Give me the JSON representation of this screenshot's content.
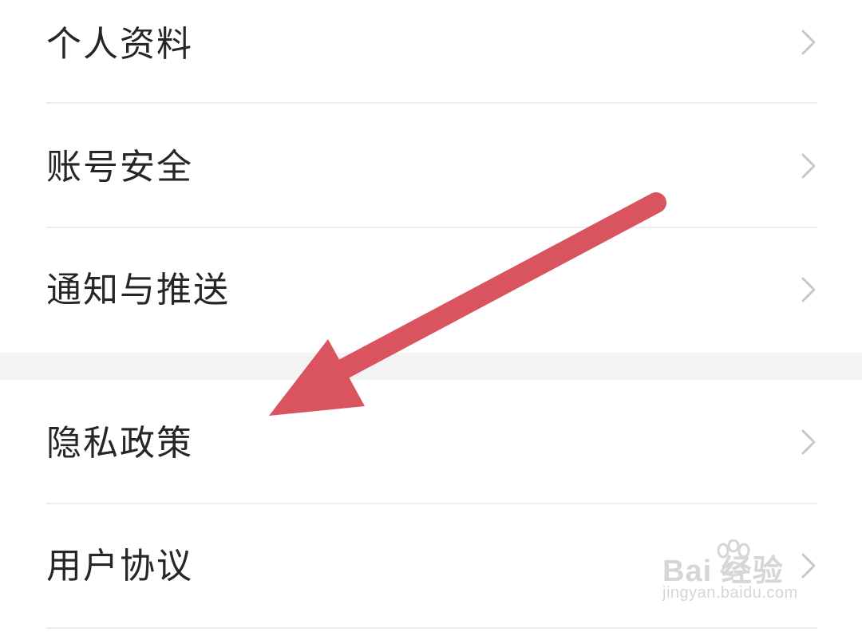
{
  "settings": {
    "group1": [
      {
        "label": "个人资料"
      },
      {
        "label": "账号安全"
      },
      {
        "label": "通知与推送"
      }
    ],
    "group2": [
      {
        "label": "隐私政策"
      },
      {
        "label": "用户协议"
      }
    ]
  },
  "watermark": {
    "brand": "Bai  经验",
    "url": "jingyan.baidu.com"
  },
  "colors": {
    "arrow": "#d9545e",
    "text": "#262626",
    "chevron": "#c8c8c8",
    "divider": "#ececec",
    "section_gap": "#f3f3f3"
  }
}
